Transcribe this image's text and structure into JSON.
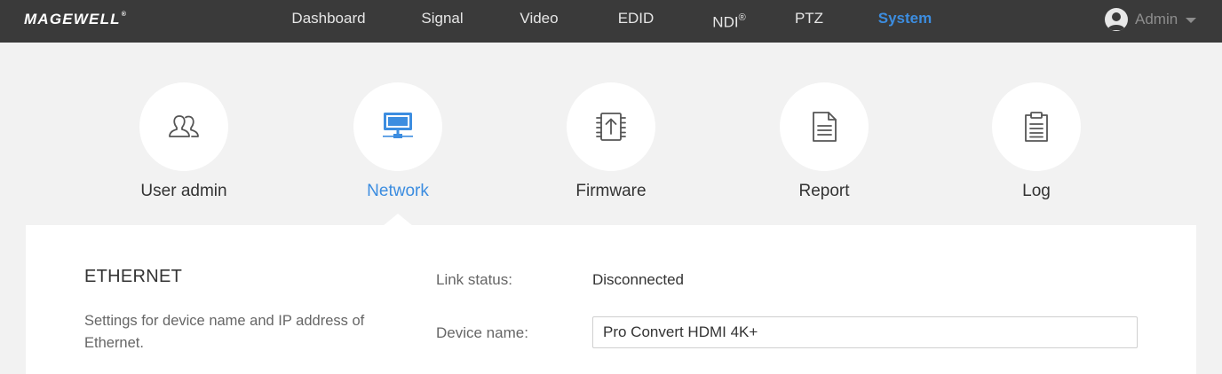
{
  "header": {
    "logo": "MAGEWELL",
    "logo_mark": "®",
    "nav": [
      {
        "label": "Dashboard"
      },
      {
        "label": "Signal"
      },
      {
        "label": "Video"
      },
      {
        "label": "EDID"
      },
      {
        "label": "NDI",
        "suffix": "®"
      },
      {
        "label": "PTZ"
      },
      {
        "label": "System",
        "active": true
      }
    ],
    "user": {
      "name": "Admin",
      "icon": "user-avatar-icon"
    }
  },
  "categories": [
    {
      "label": "User admin",
      "icon": "users-icon"
    },
    {
      "label": "Network",
      "icon": "network-monitor-icon",
      "active": true
    },
    {
      "label": "Firmware",
      "icon": "firmware-chip-icon"
    },
    {
      "label": "Report",
      "icon": "report-document-icon"
    },
    {
      "label": "Log",
      "icon": "clipboard-log-icon"
    }
  ],
  "colors": {
    "accent": "#3c8de0",
    "topbar": "#3a3a3a",
    "background": "#f2f2f2"
  },
  "section": {
    "title": "ETHERNET",
    "description": "Settings for device name and IP address of Ethernet.",
    "link_status_label": "Link status:",
    "link_status_value": "Disconnected",
    "device_name_label": "Device name:",
    "device_name_value": "Pro Convert HDMI 4K+"
  }
}
